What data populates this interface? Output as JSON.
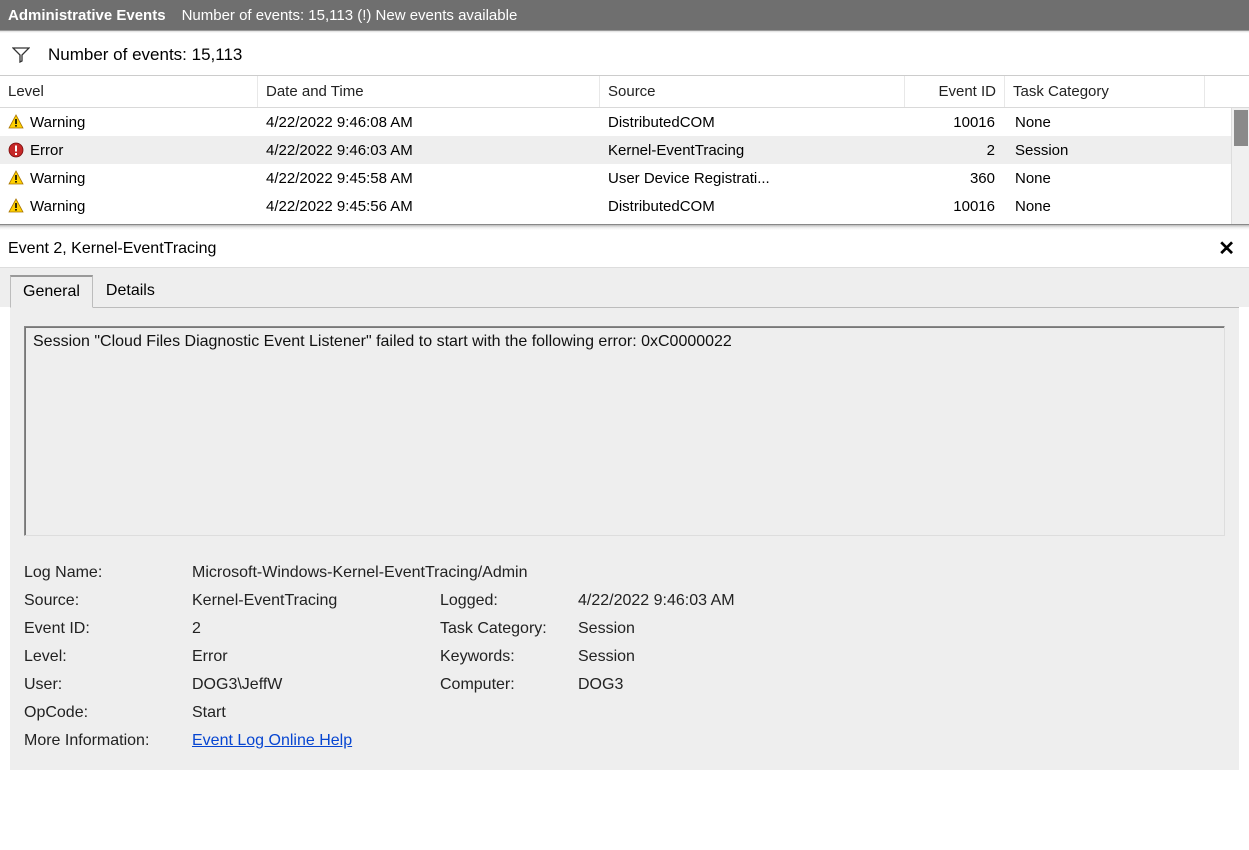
{
  "header": {
    "title": "Administrative Events",
    "subtitle": "Number of events: 15,113 (!) New events available"
  },
  "filter": {
    "text": "Number of events: 15,113"
  },
  "columns": {
    "level": "Level",
    "date": "Date and Time",
    "source": "Source",
    "eventid": "Event ID",
    "task": "Task Category"
  },
  "rows": [
    {
      "level": "Warning",
      "icon": "warning",
      "date": "4/22/2022 9:46:08 AM",
      "source": "DistributedCOM",
      "eventid": "10016",
      "task": "None",
      "selected": false
    },
    {
      "level": "Error",
      "icon": "error",
      "date": "4/22/2022 9:46:03 AM",
      "source": "Kernel-EventTracing",
      "eventid": "2",
      "task": "Session",
      "selected": true
    },
    {
      "level": "Warning",
      "icon": "warning",
      "date": "4/22/2022 9:45:58 AM",
      "source": "User Device Registrati...",
      "eventid": "360",
      "task": "None",
      "selected": false
    },
    {
      "level": "Warning",
      "icon": "warning",
      "date": "4/22/2022 9:45:56 AM",
      "source": "DistributedCOM",
      "eventid": "10016",
      "task": "None",
      "selected": false
    }
  ],
  "detail": {
    "heading": "Event 2, Kernel-EventTracing",
    "tabs": {
      "general": "General",
      "details": "Details"
    },
    "description": "Session \"Cloud Files Diagnostic Event Listener\" failed to start with the following error: 0xC0000022",
    "labels": {
      "logname": "Log Name:",
      "source": "Source:",
      "logged": "Logged:",
      "eventid": "Event ID:",
      "taskcat": "Task Category:",
      "level": "Level:",
      "keywords": "Keywords:",
      "user": "User:",
      "computer": "Computer:",
      "opcode": "OpCode:",
      "moreinfo": "More Information:"
    },
    "values": {
      "logname": "Microsoft-Windows-Kernel-EventTracing/Admin",
      "source": "Kernel-EventTracing",
      "logged": "4/22/2022 9:46:03 AM",
      "eventid": "2",
      "taskcat": "Session",
      "level": "Error",
      "keywords": "Session",
      "user": "DOG3\\JeffW",
      "computer": "DOG3",
      "opcode": "Start",
      "moreinfo": "Event Log Online Help"
    }
  }
}
